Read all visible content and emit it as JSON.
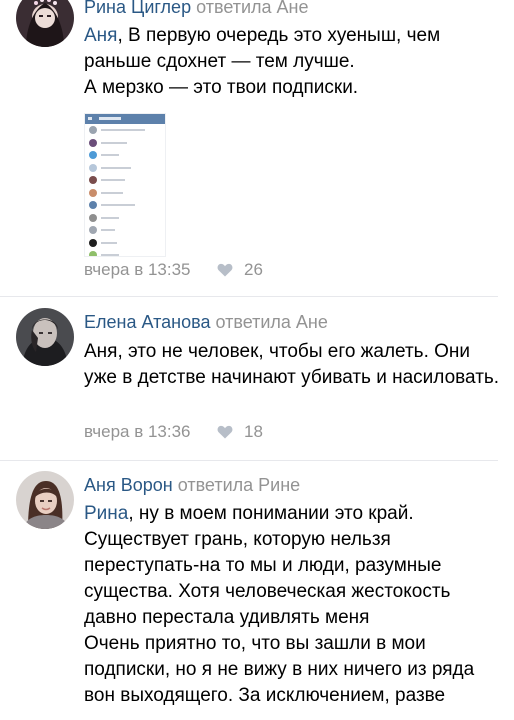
{
  "comments": [
    {
      "author": "Рина Циглер",
      "replied": "ответила Ане",
      "mention": "Аня",
      "text": ", В первую очередь это хуеныш, чем раньше сдохнет — тем лучше.\nА мерзко — это твои подписки.",
      "time": "вчера в 13:35",
      "likes": "26",
      "attachment": {
        "header": "Подписки",
        "rows": 11
      }
    },
    {
      "author": "Елена Атанова",
      "replied": "ответила Ане",
      "text": "Аня, это не человек, чтобы его жалеть. Они уже в детстве начинают убивать и насиловать.",
      "time": "вчера в 13:36",
      "likes": "18"
    },
    {
      "author": "Аня Ворон",
      "replied": "ответила Рине",
      "mention": "Рина",
      "text": ", ну в моем понимании это край. Существует грань, которую нельзя переступать-на то мы и люди, разумные существа. Хотя человеческая жестокость давно перестала удивлять меня\nОчень приятно то, что вы зашли в мои подписки, но я не вижу в них ничего из ряда вон выходящего. За исключением, разве"
    }
  ],
  "colors": {
    "link": "#2a5885",
    "muted": "#939393",
    "divider": "#e7e8ec"
  },
  "icons": [
    "heart-icon"
  ]
}
